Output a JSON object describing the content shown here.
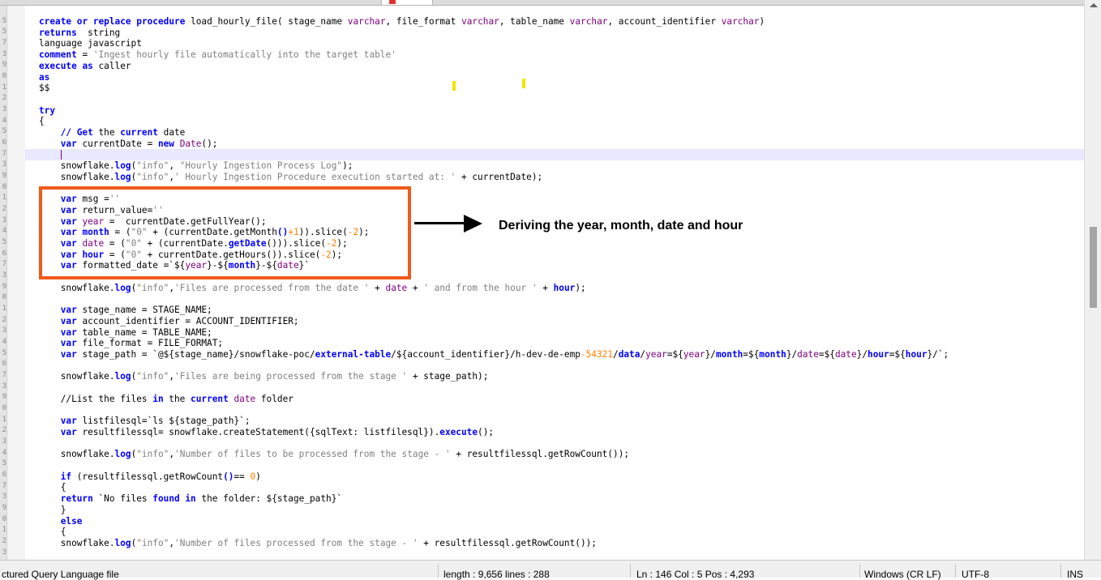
{
  "gutter": {
    "line_numbers": [
      "",
      "5",
      "5",
      "7",
      "3",
      "9",
      "0",
      "1",
      "2",
      "3",
      "4",
      "5",
      "6",
      "7",
      "3",
      "9",
      "0",
      "1",
      "2",
      "3",
      "4",
      "5",
      "6",
      "7",
      "3",
      "9",
      "0",
      "1",
      "2",
      "3",
      "4",
      "5",
      "6",
      "7",
      "3",
      "9",
      "0",
      "1",
      "2",
      "3",
      "4",
      "5",
      "6",
      "7",
      "3",
      "9",
      "0",
      "1",
      "2",
      "3"
    ]
  },
  "code": {
    "l1_kw1": "create",
    "l1_kw2": "or",
    "l1_kw3": "replace",
    "l1_kw4": "procedure",
    "l1_name": "load_hourly_file( stage_name",
    "l1_t1": "varchar",
    "l1_p2": ", file_format",
    "l1_t2": "varchar",
    "l1_p3": ", table_name",
    "l1_t3": "varchar",
    "l1_p4": ", account_identifier",
    "l1_t4": "varchar",
    "l1_end": ")",
    "l2_kw": "returns",
    "l2_val": "  string",
    "l3_val": "language javascript",
    "l4_kw": "comment",
    "l4_eq": " = ",
    "l4_str": "'Ingest hourly file automatically into the target table'",
    "l5_kw1": "execute",
    "l5_kw2": "as",
    "l5_val": " caller",
    "l6_kw": "as",
    "l7": "$$",
    "l8_kw": "try",
    "l9": "{",
    "l10_cm1": "// Get",
    "l10_cm2": " the ",
    "l10_cm3": "current",
    "l10_cm4": " date",
    "l11_kw": "var",
    "l11_a": " currentDate = ",
    "l11_new": "new",
    "l11_b": "Date",
    "l11_c": "();",
    "l12_a": "snowflake.",
    "l12_fn": "log",
    "l12_b": "(",
    "l12_s1": "\"info\"",
    "l12_c": ", ",
    "l12_s2": "\"Hourly Ingestion Process Log\"",
    "l12_d": ");",
    "l13_a": "snowflake.",
    "l13_fn": "log",
    "l13_b": "(",
    "l13_s1": "\"info\"",
    "l13_c": ",",
    "l13_s2": "' Hourly Ingestion Procedure execution started at: '",
    "l13_d": " + currentDate);",
    "l14_kw": "var",
    "l14_a": " msg =",
    "l14_s": "''",
    "l15_kw": "var",
    "l15_a": " return_value=",
    "l15_s": "''",
    "l16_kw": "var",
    "l16_v": "year",
    "l16_a": " =  currentDate.getFullYear();",
    "l17_kw": "var",
    "l17_v": "month",
    "l17_a": " = (",
    "l17_s": "\"0\"",
    "l17_b": " + (currentDate.getMonth",
    "l17_c": "()",
    "l17_n": "+1",
    "l17_d": ")).slice(",
    "l17_n2": "-2",
    "l17_e": ");",
    "l18_kw": "var",
    "l18_v": "date",
    "l18_a": " = (",
    "l18_s": "\"0\"",
    "l18_b": " + (currentDate.",
    "l18_fn": "getDate",
    "l18_c": "())).slice(",
    "l18_n": "-2",
    "l18_d": ");",
    "l19_kw": "var",
    "l19_v": "hour",
    "l19_a": " = (",
    "l19_s": "\"0\"",
    "l19_b": " + currentDate.getHours()).slice(",
    "l19_n": "-2",
    "l19_c": ");",
    "l20_kw": "var",
    "l20_a": " formatted_date =`${",
    "l20_v1": "year",
    "l20_b": "}-${",
    "l20_v2": "month",
    "l20_c": "}-${",
    "l20_v3": "date",
    "l20_d": "}`",
    "l21_a": "snowflake.",
    "l21_fn": "log",
    "l21_b": "(",
    "l21_s1": "\"info\"",
    "l21_c": ",",
    "l21_s2": "'Files are processed from the date '",
    "l21_d": " + ",
    "l21_v1": "date",
    "l21_e": " + ",
    "l21_s3": "' and from the hour '",
    "l21_f": " + ",
    "l21_v2": "hour",
    "l21_g": ");",
    "l22_kw": "var",
    "l22_a": " stage_name = STAGE_NAME;",
    "l23_kw": "var",
    "l23_a": " account_identifier = ACCOUNT_IDENTIFIER;",
    "l24_kw": "var",
    "l24_a": " table_name = TABLE_NAME;",
    "l25_kw": "var",
    "l25_a": " file_format = FILE_FORMAT;",
    "l26_kw": "var",
    "l26_a": " stage_path = `@${stage_name}/snowflake-poc/",
    "l26_v1": "external-table",
    "l26_b": "/${account_identifier}/h-dev-de-emp",
    "l26_n": "-54321",
    "l26_c": "/",
    "l26_v2": "data",
    "l26_d": "/",
    "l26_v3": "year",
    "l26_e": "=${",
    "l26_v4": "year",
    "l26_f": "}/",
    "l26_v5": "month",
    "l26_g": "=${",
    "l26_v6": "month",
    "l26_h": "}/",
    "l26_v7": "date",
    "l26_i": "=${",
    "l26_v8": "date",
    "l26_j": "}/",
    "l26_v9": "hour",
    "l26_k": "=${",
    "l26_v10": "hour",
    "l26_l": "}/`;",
    "l27_a": "snowflake.",
    "l27_fn": "log",
    "l27_b": "(",
    "l27_s1": "\"info\"",
    "l27_c": ",",
    "l27_s2": "'Files are being processed from the stage '",
    "l27_d": " + stage_path);",
    "l28_a": "//List the files ",
    "l28_kw1": "in",
    "l28_b": " the ",
    "l28_kw2": "current",
    "l28_c": " ",
    "l28_kw3": "date",
    "l28_d": " folder",
    "l29_kw": "var",
    "l29_a": " listfilesql=`ls ${stage_path}`;",
    "l30_kw": "var",
    "l30_a": " resultfilessql= snowflake.createStatement({sqlText: listfilesql}).",
    "l30_fn": "execute",
    "l30_b": "();",
    "l31_a": "snowflake.",
    "l31_fn": "log",
    "l31_b": "(",
    "l31_s1": "\"info\"",
    "l31_c": ",",
    "l31_s2": "'Number of files to be processed from the stage - '",
    "l31_d": " + resultfilessql.getRowCount());",
    "l32_kw": "if",
    "l32_a": " (resultfilessql.getRowCount",
    "l32_b": "()",
    "l32_c": "== ",
    "l32_n": "0",
    "l32_d": ")",
    "l33": "{",
    "l34_kw": "return",
    "l34_a": " `No files ",
    "l34_kw2": "found",
    "l34_b": " ",
    "l34_kw3": "in",
    "l34_c": " the folder: ${stage_path}`",
    "l35": "}",
    "l36_kw": "else",
    "l37": "{",
    "l38_a": "snowflake.",
    "l38_fn": "log",
    "l38_b": "(",
    "l38_s1": "\"info\"",
    "l38_c": ",",
    "l38_s2": "'Number of files processed from the stage - '",
    "l38_d": " + resultfilessql.getRowCount());"
  },
  "annotation": {
    "text": "Deriving the year, month, date and hour"
  },
  "statusbar": {
    "file_type": "ctured Query Language file",
    "length": "length : 9,656    lines : 288",
    "position": "Ln : 146    Col : 5    Pos : 4,293",
    "eol": "Windows (CR LF)",
    "encoding": "UTF-8",
    "mode": "INS"
  },
  "colors": {
    "keyword": "#0000ff",
    "string": "#808080",
    "number": "#ff8000",
    "comment": "#008000",
    "highlight_box": "#f05a1a",
    "marker": "#f2e600"
  }
}
